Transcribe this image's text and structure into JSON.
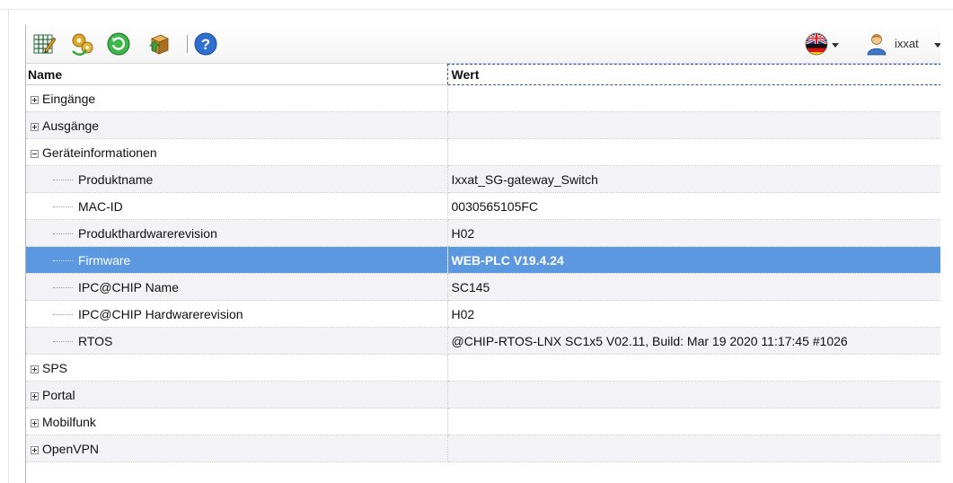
{
  "toolbar": {
    "icons": [
      "grid-edit-icon",
      "settings-gears-icon",
      "refresh-icon",
      "package-upload-icon",
      "help-icon"
    ],
    "language_icon": "uk-flag-icon",
    "user_icon": "user-icon",
    "user_name": "ixxat"
  },
  "table": {
    "headers": {
      "name": "Name",
      "value": "Wert"
    },
    "rows": [
      {
        "label": "Eingänge",
        "value": "",
        "kind": "collapsed"
      },
      {
        "label": "Ausgänge",
        "value": "",
        "kind": "collapsed"
      },
      {
        "label": "Geräteinformationen",
        "value": "",
        "kind": "expanded"
      },
      {
        "label": "Produktname",
        "value": "Ixxat_SG-gateway_Switch",
        "kind": "child"
      },
      {
        "label": "MAC-ID",
        "value": "0030565105FC",
        "kind": "child"
      },
      {
        "label": "Produkthardwarerevision",
        "value": "H02",
        "kind": "child"
      },
      {
        "label": "Firmware",
        "value": "WEB-PLC V19.4.24",
        "kind": "child",
        "selected": true
      },
      {
        "label": "IPC@CHIP Name",
        "value": "SC145",
        "kind": "child"
      },
      {
        "label": "IPC@CHIP Hardwarerevision",
        "value": "H02",
        "kind": "child"
      },
      {
        "label": "RTOS",
        "value": "@CHIP-RTOS-LNX SC1x5 V02.11, Build: Mar 19 2020 11:17:45 #1026",
        "kind": "child"
      },
      {
        "label": "SPS",
        "value": "",
        "kind": "collapsed"
      },
      {
        "label": "Portal",
        "value": "",
        "kind": "collapsed"
      },
      {
        "label": "Mobilfunk",
        "value": "",
        "kind": "collapsed"
      },
      {
        "label": "OpenVPN",
        "value": "",
        "kind": "collapsed"
      }
    ]
  },
  "colors": {
    "selected_row": "#5b98e0",
    "alt_row": "#f2f2f7",
    "header_focus_border": "#3250a0"
  }
}
